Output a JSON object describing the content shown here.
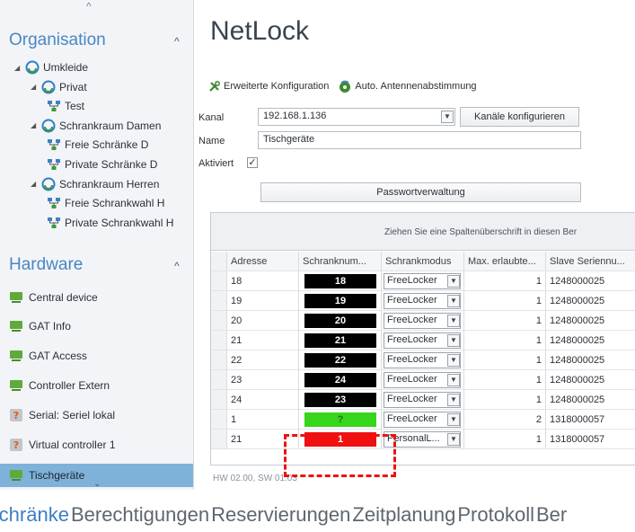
{
  "sidebar": {
    "organisation_title": "Organisation",
    "hardware_title": "Hardware",
    "tree": [
      {
        "label": "Umkleide",
        "type": "gear",
        "level": 0
      },
      {
        "label": "Privat",
        "type": "gear",
        "level": 1
      },
      {
        "label": "Test",
        "type": "net",
        "level": 2
      },
      {
        "label": "Schrankraum Damen",
        "type": "gear",
        "level": 1
      },
      {
        "label": "Freie Schränke D",
        "type": "net",
        "level": 2
      },
      {
        "label": "Private Schränke D",
        "type": "net",
        "level": 2
      },
      {
        "label": "Schrankraum Herren",
        "type": "gear",
        "level": 1
      },
      {
        "label": "Freie Schrankwahl H",
        "type": "net",
        "level": 2
      },
      {
        "label": "Private Schrankwahl H",
        "type": "net",
        "level": 2
      }
    ],
    "hardware": [
      {
        "label": "Central device",
        "icon": "device-icon"
      },
      {
        "label": "GAT Info",
        "icon": "device-icon"
      },
      {
        "label": "GAT Access",
        "icon": "device-icon"
      },
      {
        "label": "Controller Extern",
        "icon": "device-icon"
      },
      {
        "label": "Serial: Seriel lokal",
        "icon": "warning-icon"
      },
      {
        "label": "Virtual controller 1",
        "icon": "warning-icon"
      },
      {
        "label": "Tischgeräte",
        "icon": "device-icon",
        "selected": true
      }
    ]
  },
  "main": {
    "title": "NetLock",
    "toolbar": {
      "config_label": "Erweiterte Konfiguration",
      "antenna_label": "Auto. Antennenabstimmung"
    },
    "form": {
      "kanal_label": "Kanal",
      "kanal_value": "192.168.1.136",
      "kanal_button": "Kanäle konfigurieren",
      "name_label": "Name",
      "name_value": "Tischgeräte",
      "aktiviert_label": "Aktiviert",
      "aktiviert_checked": true,
      "password_button": "Passwortverwaltung"
    },
    "grid": {
      "group_hint": "Ziehen Sie eine Spaltenüberschrift in diesen Ber",
      "columns": [
        "Adresse",
        "Schranknum...",
        "Schrankmodus",
        "Max. erlaubte...",
        "Slave Seriennu..."
      ],
      "rows": [
        {
          "adresse": "18",
          "schranknummer": "18",
          "color": "#000000",
          "modus": "FreeLocker",
          "max": "1",
          "serial": "1248000025"
        },
        {
          "adresse": "19",
          "schranknummer": "19",
          "color": "#000000",
          "modus": "FreeLocker",
          "max": "1",
          "serial": "1248000025"
        },
        {
          "adresse": "20",
          "schranknummer": "20",
          "color": "#000000",
          "modus": "FreeLocker",
          "max": "1",
          "serial": "1248000025"
        },
        {
          "adresse": "21",
          "schranknummer": "21",
          "color": "#000000",
          "modus": "FreeLocker",
          "max": "1",
          "serial": "1248000025"
        },
        {
          "adresse": "22",
          "schranknummer": "22",
          "color": "#000000",
          "modus": "FreeLocker",
          "max": "1",
          "serial": "1248000025"
        },
        {
          "adresse": "23",
          "schranknummer": "24",
          "color": "#000000",
          "modus": "FreeLocker",
          "max": "1",
          "serial": "1248000025"
        },
        {
          "adresse": "24",
          "schranknummer": "23",
          "color": "#000000",
          "modus": "FreeLocker",
          "max": "1",
          "serial": "1248000025"
        },
        {
          "adresse": "1",
          "schranknummer": "?",
          "color": "#35d61b",
          "modus": "FreeLocker",
          "max": "2",
          "serial": "1318000057"
        },
        {
          "adresse": "21",
          "schranknummer": "1",
          "color": "#f01010",
          "modus": "PersonalL...",
          "max": "1",
          "serial": "1318000057"
        }
      ]
    },
    "hw_version": "HW 02.00, SW 01.03"
  },
  "tabs": [
    "Schränke",
    "Berechtigungen",
    "Reservierungen",
    "Zeitplanung",
    "Protokoll",
    "Ber"
  ],
  "active_tab": "Schränke",
  "colors": {
    "accent": "#4a86c5",
    "selected_row": "#7fb2d8",
    "annotation": "#ee1111"
  }
}
